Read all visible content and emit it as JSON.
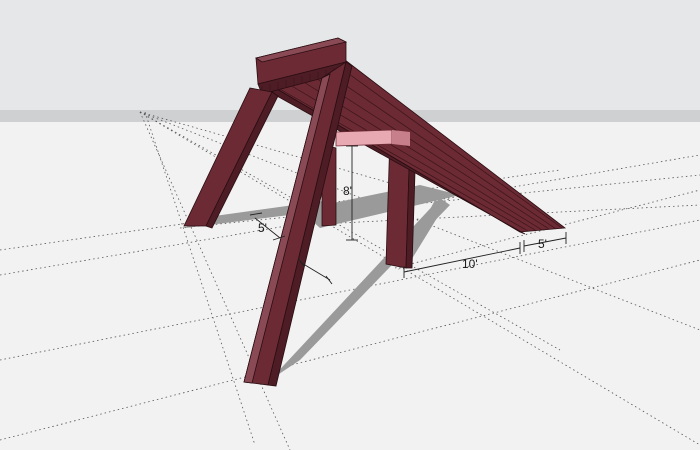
{
  "scene": {
    "sky_color": "#e6e7e8",
    "ground_color": "#f2f2f2",
    "wood_color": "#6b2a34",
    "wood_dark": "#4d1c24",
    "wood_light": "#8a4a55",
    "highlight_color": "#e8a9b3",
    "shadow_color": "#9a9a9a"
  },
  "dimensions": {
    "height_label": "8'",
    "short_span_label": "5'",
    "long_span_label": "10'",
    "overhang_label": "5'"
  }
}
